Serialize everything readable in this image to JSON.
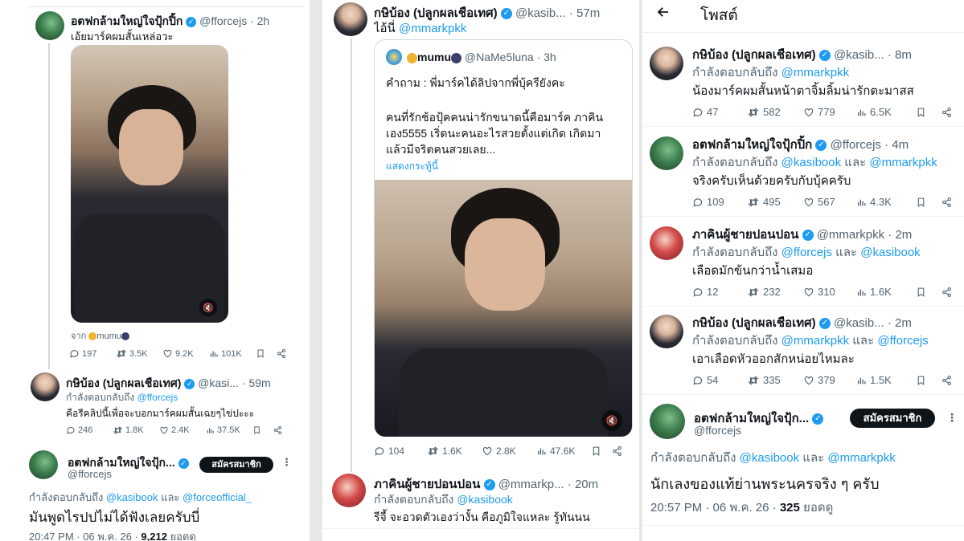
{
  "panel1": {
    "tweet_main": {
      "name": "อตฟกล้ามใหญ่ใจปุ้กปิ้ก",
      "handle": "@fforcejs",
      "time": "· 2h",
      "text": "เอ้ยมาร์คผมสั้นเหล่อวะ",
      "source_prefix": "จาก",
      "source_name": "mumu",
      "stats": {
        "replies": "197",
        "retweets": "3.5K",
        "likes": "9.2K",
        "views": "101K"
      }
    },
    "reply_kasi": {
      "name": "กษิบ้อง (ปลูกผลเชือเทศ)",
      "handle": "@kasi...",
      "time": "· 59m",
      "reply_prefix": "กำลังตอบกลับถึง",
      "reply_to": "@fforcejs",
      "text": "คือรีคลิปนี้เพื่อจะบอกมาร์คผมสั้นเฉยๆไข่ปะะะ",
      "stats": {
        "replies": "246",
        "retweets": "1.8K",
        "likes": "2.4K",
        "views": "37.5K"
      }
    },
    "focus": {
      "name": "อตฟกล้ามใหญ่ใจปุ้ก...",
      "handle": "@fforcejs",
      "subscribe": "สมัครสมาชิก",
      "reply_prefix": "กำลังตอบกลับถึง",
      "reply_to_1": "@kasibook",
      "conj": "และ",
      "reply_to_2": "@forceofficial_",
      "text": "มันพูดไรปปไม่ได้ฟังเลยครับบี่",
      "timestamp": "20:47 PM · 06 พ.ค. 26 · ",
      "views_count": "9,212",
      "views_label": "ยอดดู"
    }
  },
  "panel2": {
    "tweet_main": {
      "name": "กษิบ้อง (ปลูกผลเชือเทศ)",
      "handle": "@kasib...",
      "time": "· 57m",
      "text_prefix": "ไอ้นี่",
      "text_mention": "@mmarkpkk",
      "quote": {
        "name": "mumu",
        "handle": "@NaMe5luna",
        "time": "· 3h",
        "line1": "คำถาม : พี่มาร์คได้ลิปจากพี่บุ้ครียังคะ",
        "line2": "คนที่รักช้อปุ้คคนน่ารักขนาดนี้คือมาร์ค ภาคิน",
        "line3": "เอง5555 เริ่ดนะคนอะไรสวยตั้งแต่เกิด เกิดมา",
        "line4": "แล้วมีจริตคนสวยเลย...",
        "show_more": "แสดงกระทู้นี้"
      },
      "stats": {
        "replies": "104",
        "retweets": "1.6K",
        "likes": "2.8K",
        "views": "47.6K"
      }
    },
    "reply_bhak": {
      "name": "ภาคินผู้ชายปอนปอน",
      "handle": "@mmarkp...",
      "time": "· 20m",
      "reply_prefix": "กำลังตอบกลับถึง",
      "reply_to": "@kasibook",
      "text": "รีจี้ จะอวดตัวเองว่างั้น คือภูมิใจแหละ รู้ทันนน"
    }
  },
  "panel3": {
    "header_title": "โพสต์",
    "replies": [
      {
        "name": "กษิบ้อง (ปลูกผลเชือเทศ)",
        "handle": "@kasib...",
        "time": "· 8m",
        "reply_prefix": "กำลังตอบกลับถึง",
        "reply_to_1": "@mmarkpkk",
        "conj": "",
        "reply_to_2": "",
        "text": "น้องมาร์คผมสั้นหน้าตาจิ้มลิ้มน่ารักตะมาสส",
        "stats": {
          "replies": "47",
          "retweets": "582",
          "likes": "779",
          "views": "6.5K"
        }
      },
      {
        "name": "อตฟกล้ามใหญ่ใจปุ้กปิ้ก",
        "handle": "@fforcejs",
        "time": "· 4m",
        "reply_prefix": "กำลังตอบกลับถึง",
        "reply_to_1": "@kasibook",
        "conj": "และ",
        "reply_to_2": "@mmarkpkk",
        "text": "จริงครับเห็นด้วยครับกับบุ้คครับ",
        "stats": {
          "replies": "109",
          "retweets": "495",
          "likes": "567",
          "views": "4.3K"
        }
      },
      {
        "name": "ภาคินผู้ชายปอนปอน",
        "handle": "@mmarkpkk",
        "time": "· 2m",
        "reply_prefix": "กำลังตอบกลับถึง",
        "reply_to_1": "@fforcejs",
        "conj": "และ",
        "reply_to_2": "@kasibook",
        "text": "เลือดมักข้นกว่าน้ำเสมอ",
        "stats": {
          "replies": "12",
          "retweets": "232",
          "likes": "310",
          "views": "1.6K"
        }
      },
      {
        "name": "กษิบ้อง (ปลูกผลเชือเทศ)",
        "handle": "@kasib...",
        "time": "· 2m",
        "reply_prefix": "กำลังตอบกลับถึง",
        "reply_to_1": "@mmarkpkk",
        "conj": "และ",
        "reply_to_2": "@fforcejs",
        "text": "เอาเลือดหัวออกสักหน่อยไหมละ",
        "stats": {
          "replies": "54",
          "retweets": "335",
          "likes": "379",
          "views": "1.5K"
        }
      }
    ],
    "focus": {
      "name": "อตฟกล้ามใหญ่ใจปุ้ก...",
      "handle": "@fforcejs",
      "subscribe": "สมัครสมาชิก",
      "reply_prefix": "กำลังตอบกลับถึง",
      "reply_to_1": "@kasibook",
      "conj": "และ",
      "reply_to_2": "@mmarkpkk",
      "text": "นักเลงของแท้ย่านพระนครจริง ๆ ครับ",
      "timestamp": "20:57 PM · 06 พ.ค. 26 · ",
      "views_count": "325",
      "views_label": "ยอดดู"
    }
  },
  "colors": {
    "accent": "#1d9bf0",
    "text": "#0f1419",
    "muted": "#536471"
  }
}
